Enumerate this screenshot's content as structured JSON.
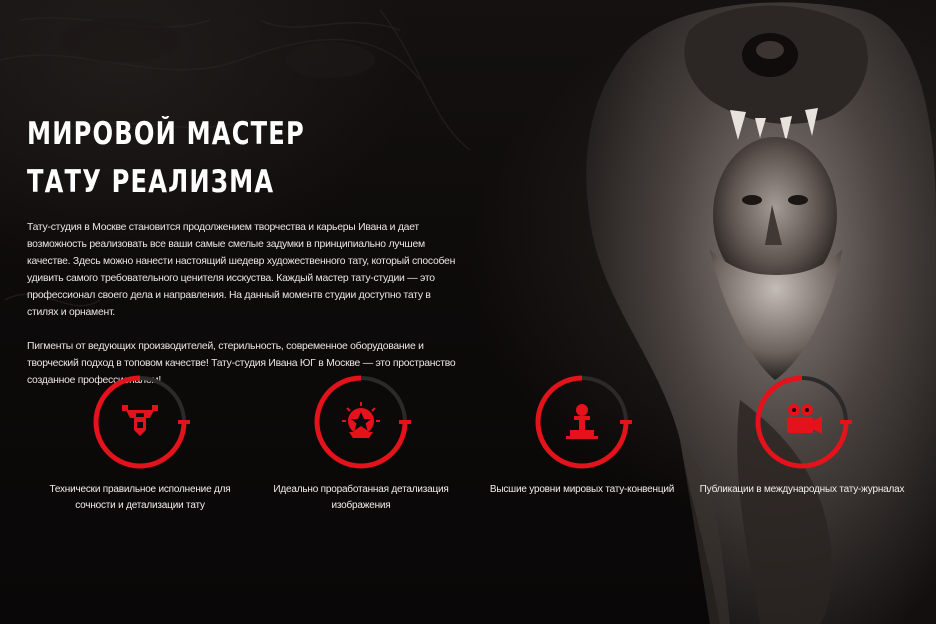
{
  "hero": {
    "title_line1": "МИРОВОЙ МАСТЕР",
    "title_line2": "ТАТУ РЕАЛИЗМА",
    "paragraph1": "Тату-студия в Москве становится продолжением творчества и карьеры Ивана и дает возможность реализовать все ваши самые смелые задумки в принципиально лучшем качестве. Здесь можно нанести настоящий шедевр художественного тату, который способен удивить самого требовательного ценителя исскуства. Каждый мастер тату-студии — это профессионал своего дела и направления. На данный моментв студии доступно тату в стилях и орнамент.",
    "paragraph2": "Пигменты от ведующих производителей, стерильность, современное оборудование и творческий подход в топовом качестве! Тату-студия Ивана ЮГ в Москве — это пространство созданное профессионалом!"
  },
  "features": [
    {
      "icon": "robot-crest-icon",
      "caption": "Технически правильное исполнение для сочности и детализации тату"
    },
    {
      "icon": "star-medal-icon",
      "caption": "Идеально проработанная детализация изображения"
    },
    {
      "icon": "award-podium-icon",
      "caption": "Высшие уровни мировых тату-конвенций"
    },
    {
      "icon": "movie-camera-icon",
      "caption": "Публикации в международных тату-журналах"
    }
  ],
  "colors": {
    "accent": "#e3121b",
    "background": "#0b0909",
    "text": "#ffffff",
    "ring_track": "#2b2929"
  }
}
